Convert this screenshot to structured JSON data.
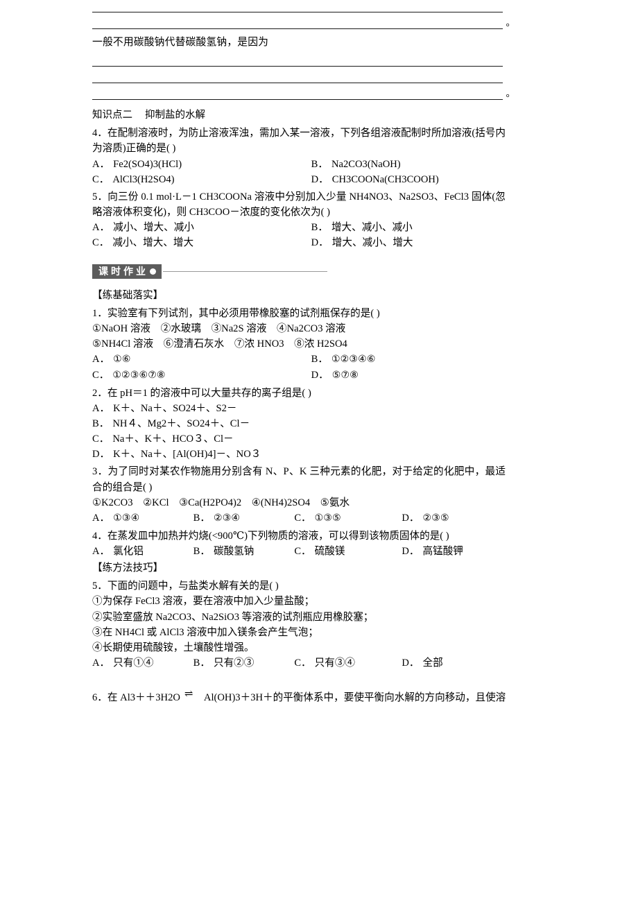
{
  "answer_blanks_top": {
    "rules": 2,
    "end_mark": "。"
  },
  "prompt": "一般不用碳酸钠代替碳酸氢钠，是因为",
  "answer_blanks_mid": {
    "rules": 3,
    "end_mark": "。"
  },
  "knowledge_point": {
    "label": "知识点二",
    "title": "抑制盐的水解"
  },
  "questions_top": [
    {
      "number": "4．",
      "stem": "在配制溶液时，为防止溶液浑浊，需加入某一溶液，下列各组溶液配制时所加溶液(括号内为溶质)正确的是(        )",
      "layout": "two",
      "options": [
        {
          "label": "A．",
          "text": "Fe2(SO4)3(HCl)"
        },
        {
          "label": "B．",
          "text": "Na2CO3(NaOH)"
        },
        {
          "label": "C．",
          "text": "AlCl3(H2SO4)"
        },
        {
          "label": "D．",
          "text": "CH3COONa(CH3COOH)"
        }
      ]
    },
    {
      "number": "5．",
      "stem": "向三份 0.1 mol·L－1 CH3COONa 溶液中分别加入少量 NH4NO3、Na2SO3、FeCl3 固体(忽略溶液体积变化)，则 CH3COO－浓度的变化依次为(        )",
      "layout": "two",
      "options": [
        {
          "label": "A．",
          "text": "减小、增大、减小"
        },
        {
          "label": "B．",
          "text": "增大、减小、减小"
        },
        {
          "label": "C．",
          "text": "减小、增大、增大"
        },
        {
          "label": "D．",
          "text": "增大、减小、增大"
        }
      ]
    }
  ],
  "worksheet": {
    "badge_text": "课时作业",
    "badge_dot": "bullet-dot"
  },
  "section_basics": "【练基础落实】",
  "section_methods": "【练方法技巧】",
  "questions_bottom": [
    {
      "number": "1．",
      "stem": "实验室有下列试剂，其中必须用带橡胶塞的试剂瓶保存的是(        )",
      "items": [
        "①NaOH 溶液　②水玻璃　③Na2S 溶液　④Na2CO3 溶液",
        "⑤NH4Cl 溶液　⑥澄清石灰水　⑦浓 HNO3　⑧浓 H2SO4"
      ],
      "layout": "two",
      "options": [
        {
          "label": "A．",
          "text": "①⑥"
        },
        {
          "label": "B．",
          "text": "①②③④⑥"
        },
        {
          "label": "C．",
          "text": "①②③⑥⑦⑧"
        },
        {
          "label": "D．",
          "text": "⑤⑦⑧"
        }
      ]
    },
    {
      "number": "2．",
      "stem": "在 pH＝1 的溶液中可以大量共存的离子组是(        )",
      "layout": "stack",
      "options": [
        {
          "label": "A．",
          "text": "K＋、Na＋、SO24＋、S2－"
        },
        {
          "label": "B．",
          "text": "NH４、Mg2＋、SO24＋、Cl－"
        },
        {
          "label": "C．",
          "text": "Na＋、K＋、HCO３、Cl－"
        },
        {
          "label": "D．",
          "text": "K＋、Na＋、[Al(OH)4]－、NO３"
        }
      ]
    },
    {
      "number": "3．",
      "stem": "为了同时对某农作物施用分别含有 N、P、K 三种元素的化肥，对于给定的化肥中，最适合的组合是(        )",
      "items": [
        "①K2CO3　②KCl　③Ca(H2PO4)2　④(NH4)2SO4　⑤氨水"
      ],
      "layout": "four",
      "options": [
        {
          "label": "A．",
          "text": "①③④"
        },
        {
          "label": "B．",
          "text": "②③④"
        },
        {
          "label": "C．",
          "text": "①③⑤"
        },
        {
          "label": "D．",
          "text": "②③⑤"
        }
      ]
    },
    {
      "number": "4．",
      "stem": "在蒸发皿中加热并灼烧(<900℃)下列物质的溶液，可以得到该物质固体的是(        )",
      "layout": "four",
      "options": [
        {
          "label": "A．",
          "text": "氯化铝"
        },
        {
          "label": "B．",
          "text": "碳酸氢钠"
        },
        {
          "label": "C．",
          "text": "硫酸镁"
        },
        {
          "label": "D．",
          "text": "高锰酸钾"
        }
      ]
    },
    {
      "number": "5．",
      "stem": "下面的问题中，与盐类水解有关的是(        )",
      "items": [
        "①为保存 FeCl3 溶液，要在溶液中加入少量盐酸；",
        "②实验室盛放 Na2CO3、Na2SiO3 等溶液的试剂瓶应用橡胶塞；",
        "③在 NH4Cl 或 AlCl3 溶液中加入镁条会产生气泡；",
        "④长期使用硫酸铵，土壤酸性增强。"
      ],
      "layout": "four",
      "options": [
        {
          "label": "A．",
          "text": "只有①④"
        },
        {
          "label": "B．",
          "text": "只有②③"
        },
        {
          "label": "C．",
          "text": "只有③④"
        },
        {
          "label": "D．",
          "text": "全部"
        }
      ]
    }
  ],
  "question6": {
    "number": "6．",
    "part1": "在 Al3＋＋3H2O",
    "arrow": "⇌",
    "part2": "Al(OH)3＋3H＋的平衡体系中，要使平衡向水解的方向移动，且使溶"
  }
}
